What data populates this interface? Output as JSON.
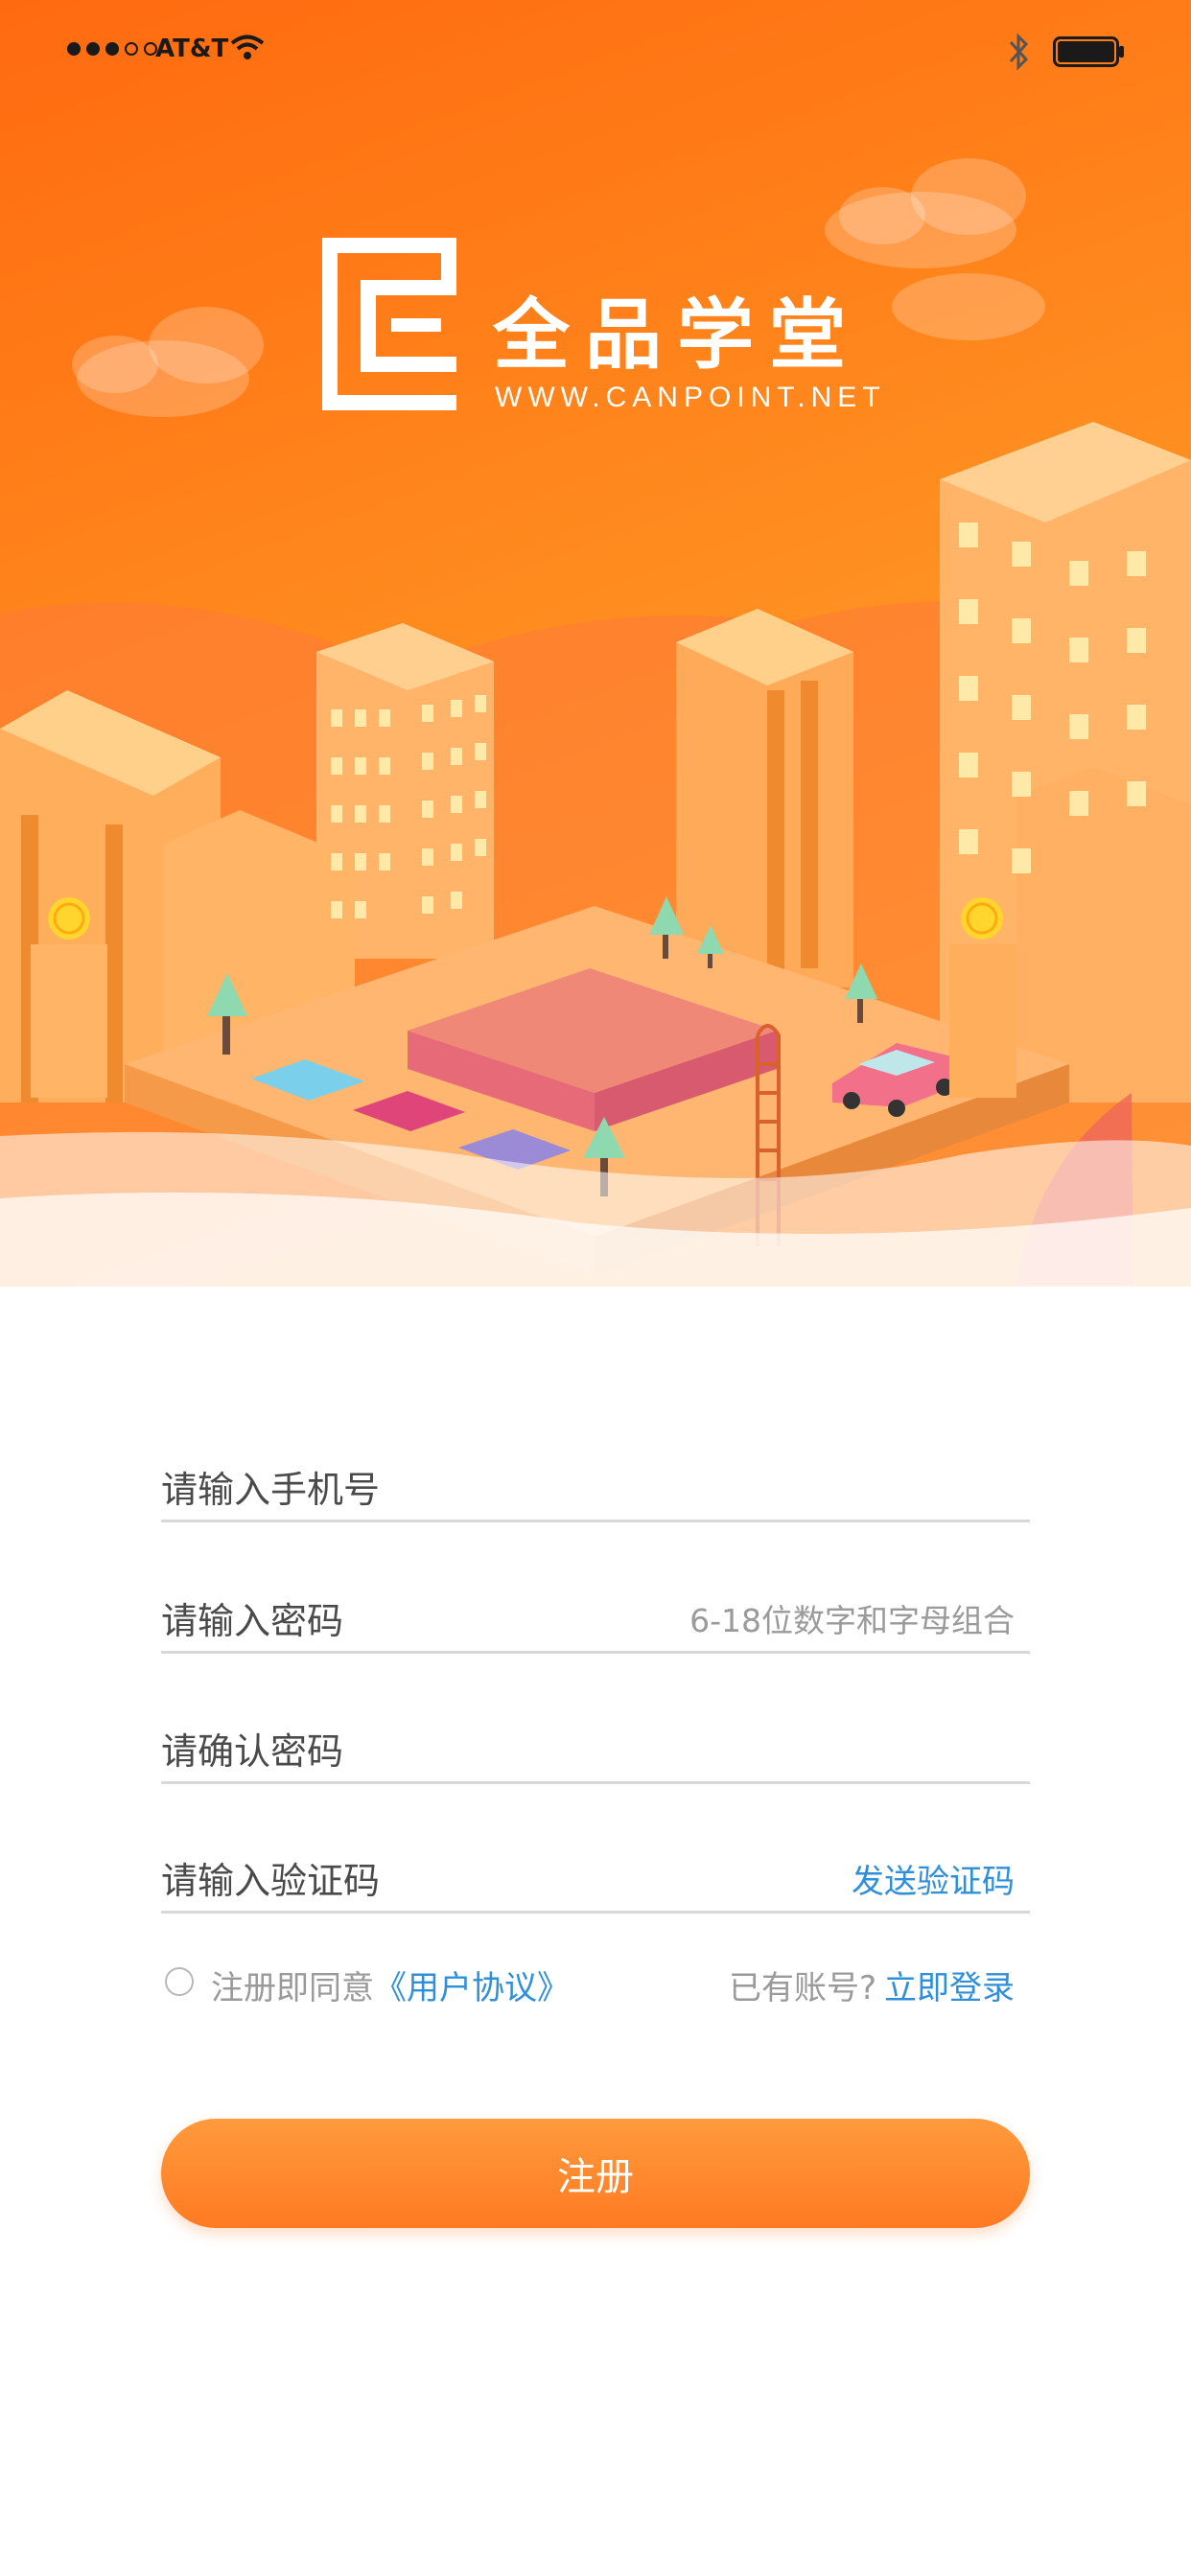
{
  "status_bar": {
    "carrier": "AT&T",
    "signal_bars_filled": 3,
    "signal_bars_total": 5
  },
  "brand": {
    "name": "全品学堂",
    "url": "WWW.CANPOINT.NET"
  },
  "form": {
    "phone": {
      "placeholder": "请输入手机号"
    },
    "password": {
      "placeholder": "请输入密码",
      "hint": "6-18位数字和字母组合"
    },
    "confirm_password": {
      "placeholder": "请确认密码"
    },
    "verify_code": {
      "placeholder": "请输入验证码",
      "action": "发送验证码"
    }
  },
  "agreement": {
    "prefix": "注册即同意",
    "link": "《用户协议》",
    "checked": false
  },
  "login": {
    "prompt": "已有账号?",
    "link": "立即登录"
  },
  "register_button": {
    "label": "注册"
  },
  "colors": {
    "accent": "#ff7a22",
    "link": "#2f8fd8",
    "hero_top": "#ff6a10",
    "hero_bottom": "#ffb032"
  }
}
